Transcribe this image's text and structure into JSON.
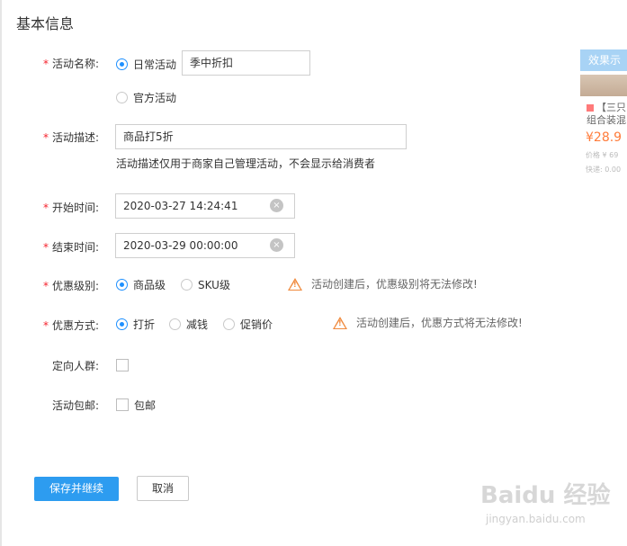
{
  "section_title": "基本信息",
  "required_mark": "*",
  "activity_name": {
    "label": "活动名称:",
    "options": [
      "日常活动",
      "官方活动"
    ],
    "value": "季中折扣"
  },
  "activity_desc": {
    "label": "活动描述:",
    "value": "商品打5折",
    "hint": "活动描述仅用于商家自己管理活动，不会显示给消费者"
  },
  "start_time": {
    "label": "开始时间:",
    "value": "2020-03-27 14:24:41"
  },
  "end_time": {
    "label": "结束时间:",
    "value": "2020-03-29 00:00:00"
  },
  "discount_level": {
    "label": "优惠级别:",
    "options": [
      "商品级",
      "SKU级"
    ],
    "warning": "活动创建后，优惠级别将无法修改!"
  },
  "discount_type": {
    "label": "优惠方式:",
    "options": [
      "打折",
      "减钱",
      "促销价"
    ],
    "warning": "活动创建后，优惠方式将无法修改!"
  },
  "target_crowd": {
    "label": "定向人群:"
  },
  "free_shipping": {
    "label": "活动包邮:",
    "option": "包邮"
  },
  "buttons": {
    "save": "保存并继续",
    "cancel": "取消"
  },
  "preview": {
    "title": "效果示",
    "name_line1": "【三只",
    "name_line2": "组合装混",
    "price": "¥28.9",
    "original_price": "价格 ¥ 69",
    "shipping": "快递: 0.00"
  },
  "watermark": {
    "text": "Baidu 经验",
    "sub": "jingyan.baidu.com"
  },
  "colors": {
    "accent": "#2d9cf0",
    "required": "#f5222d",
    "warning": "#f08a3e"
  },
  "icons": {
    "clear": "close-circle-icon",
    "warning": "warning-triangle-icon"
  }
}
